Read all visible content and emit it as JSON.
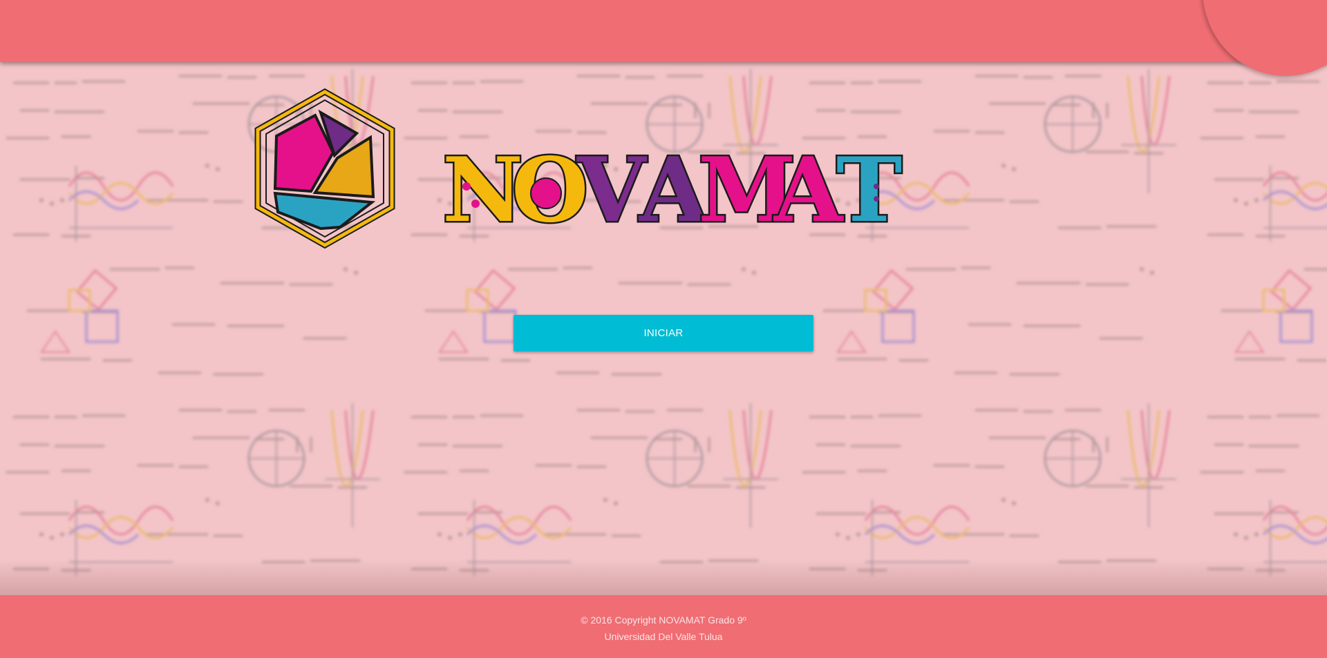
{
  "header": {
    "background": "#ef6d73"
  },
  "logo": {
    "icon": "hexagon-logo-icon",
    "wordmark": "NOVAMAT",
    "letter_colors": [
      "#f5b90e",
      "#f5b90e",
      "#7b2c8c",
      "#6f2c86",
      "#e5118a",
      "#e5118a",
      "#2aa3c3"
    ]
  },
  "main": {
    "start_button_label": "INICIAR",
    "start_button_color": "#00bcd4",
    "background_icon": "math-formulas-pattern-icon"
  },
  "footer": {
    "copyright": "© 2016 Copyright NOVAMAT Grado 9º",
    "institution": "Universidad Del Valle Tulua"
  }
}
